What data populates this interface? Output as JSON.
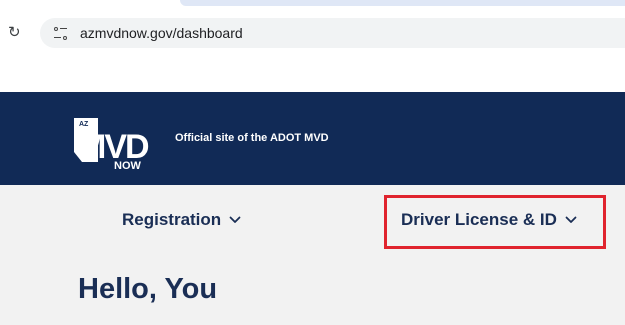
{
  "browser": {
    "url": "azmvdnow.gov/dashboard"
  },
  "header": {
    "logo_text_top": "AZ",
    "logo_text_main": "MVD",
    "logo_text_bottom": "NOW",
    "tagline": "Official site of the ADOT MVD"
  },
  "nav": {
    "items": [
      {
        "label": "Registration"
      },
      {
        "label": "Driver License & ID"
      }
    ]
  },
  "main": {
    "greeting": "Hello, You"
  },
  "colors": {
    "header_bg": "#112a56",
    "nav_text": "#1a2e55",
    "highlight": "#e0242e"
  }
}
